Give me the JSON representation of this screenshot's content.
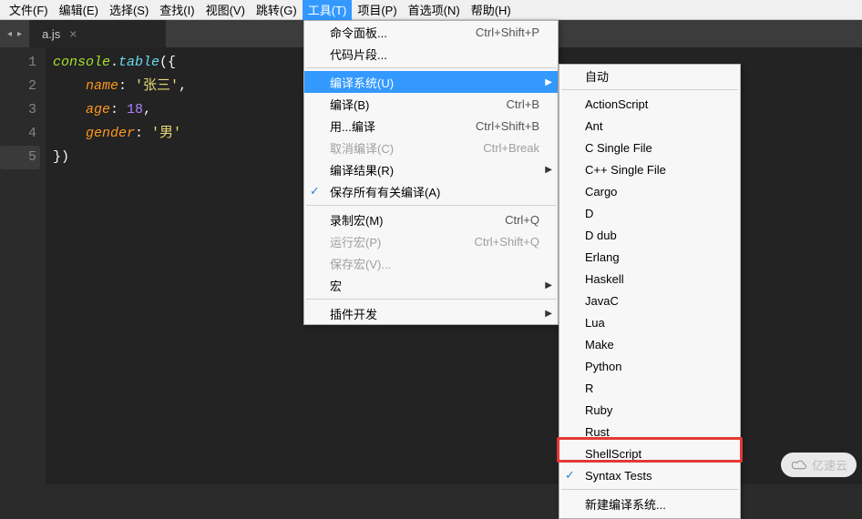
{
  "menubar": [
    "文件(F)",
    "编辑(E)",
    "选择(S)",
    "查找(I)",
    "视图(V)",
    "跳转(G)",
    "工具(T)",
    "项目(P)",
    "首选项(N)",
    "帮助(H)"
  ],
  "menubar_active": 6,
  "tab": {
    "name": "a.js"
  },
  "gutter": [
    "1",
    "2",
    "3",
    "4",
    "5"
  ],
  "gutter_current": 4,
  "code": {
    "lines": [
      [
        [
          "tok-ident",
          "console"
        ],
        [
          "tok-punc",
          "."
        ],
        [
          "tok-prop",
          "table"
        ],
        [
          "tok-punc",
          "({"
        ]
      ],
      [
        [
          "",
          "    "
        ],
        [
          "tok-attr",
          "name"
        ],
        [
          "tok-punc",
          ": "
        ],
        [
          "tok-str",
          "'张三'"
        ],
        [
          "tok-punc",
          ","
        ]
      ],
      [
        [
          "",
          "    "
        ],
        [
          "tok-attr",
          "age"
        ],
        [
          "tok-punc",
          ": "
        ],
        [
          "tok-num",
          "18"
        ],
        [
          "tok-punc",
          ","
        ]
      ],
      [
        [
          "",
          "    "
        ],
        [
          "tok-attr",
          "gender"
        ],
        [
          "tok-punc",
          ": "
        ],
        [
          "tok-str",
          "'男'"
        ]
      ],
      [
        [
          "tok-punc",
          "})"
        ]
      ]
    ]
  },
  "tools_menu": [
    {
      "label": "命令面板...",
      "shortcut": "Ctrl+Shift+P"
    },
    {
      "label": "代码片段..."
    },
    {
      "sep": true
    },
    {
      "label": "编译系统(U)",
      "arrow": true,
      "highlight": true
    },
    {
      "label": "编译(B)",
      "shortcut": "Ctrl+B"
    },
    {
      "label": "用...编译",
      "shortcut": "Ctrl+Shift+B"
    },
    {
      "label": "取消编译(C)",
      "shortcut": "Ctrl+Break",
      "disabled": true
    },
    {
      "label": "编译结果(R)",
      "arrow": true
    },
    {
      "label": "保存所有有关编译(A)",
      "checked": true
    },
    {
      "sep": true
    },
    {
      "label": "录制宏(M)",
      "shortcut": "Ctrl+Q"
    },
    {
      "label": "运行宏(P)",
      "shortcut": "Ctrl+Shift+Q",
      "disabled": true
    },
    {
      "label": "保存宏(V)...",
      "disabled": true
    },
    {
      "label": "宏",
      "arrow": true
    },
    {
      "sep": true
    },
    {
      "label": "插件开发",
      "arrow": true
    }
  ],
  "build_submenu": [
    {
      "label": "自动"
    },
    {
      "sep": true
    },
    {
      "label": "ActionScript"
    },
    {
      "label": "Ant"
    },
    {
      "label": "C Single File"
    },
    {
      "label": "C++ Single File"
    },
    {
      "label": "Cargo"
    },
    {
      "label": "D"
    },
    {
      "label": "D dub"
    },
    {
      "label": "Erlang"
    },
    {
      "label": "Haskell"
    },
    {
      "label": "JavaC"
    },
    {
      "label": "Lua"
    },
    {
      "label": "Make"
    },
    {
      "label": "Python"
    },
    {
      "label": "R"
    },
    {
      "label": "Ruby"
    },
    {
      "label": "Rust"
    },
    {
      "label": "ShellScript"
    },
    {
      "label": "Syntax Tests",
      "checked": true
    },
    {
      "sep": true
    },
    {
      "label": "新建编译系统..."
    }
  ],
  "watermark": "亿速云"
}
